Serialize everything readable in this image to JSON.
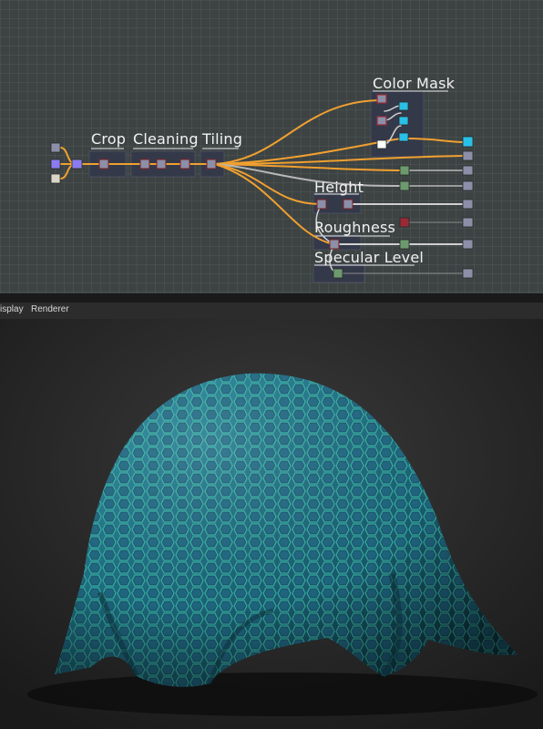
{
  "graph": {
    "frames": {
      "crop": "Crop",
      "cleaning": "Cleaning",
      "tiling": "Tiling",
      "color_mask": "Color Mask",
      "height": "Height",
      "roughness": "Roughness",
      "specular_level": "Specular Level"
    },
    "colors": {
      "background": "#3d4343",
      "wire_orange": "#f0a030",
      "wire_gray": "#b8b8b8",
      "node_gray": "#8c8fa8",
      "node_purple": "#8a7cf0",
      "node_cyan": "#29c0e8",
      "node_green": "#6c9a6e",
      "node_red": "#9a2a35",
      "frame_bg": "#34394a"
    }
  },
  "viewport": {
    "tabs": [
      "isplay",
      "Renderer"
    ],
    "scene": "teal-hexagon-fabric-draped",
    "colors": {
      "fabric": "#1e6d82",
      "hex_edge": "#3ab7a8",
      "floor": "#1f1f1f"
    }
  }
}
